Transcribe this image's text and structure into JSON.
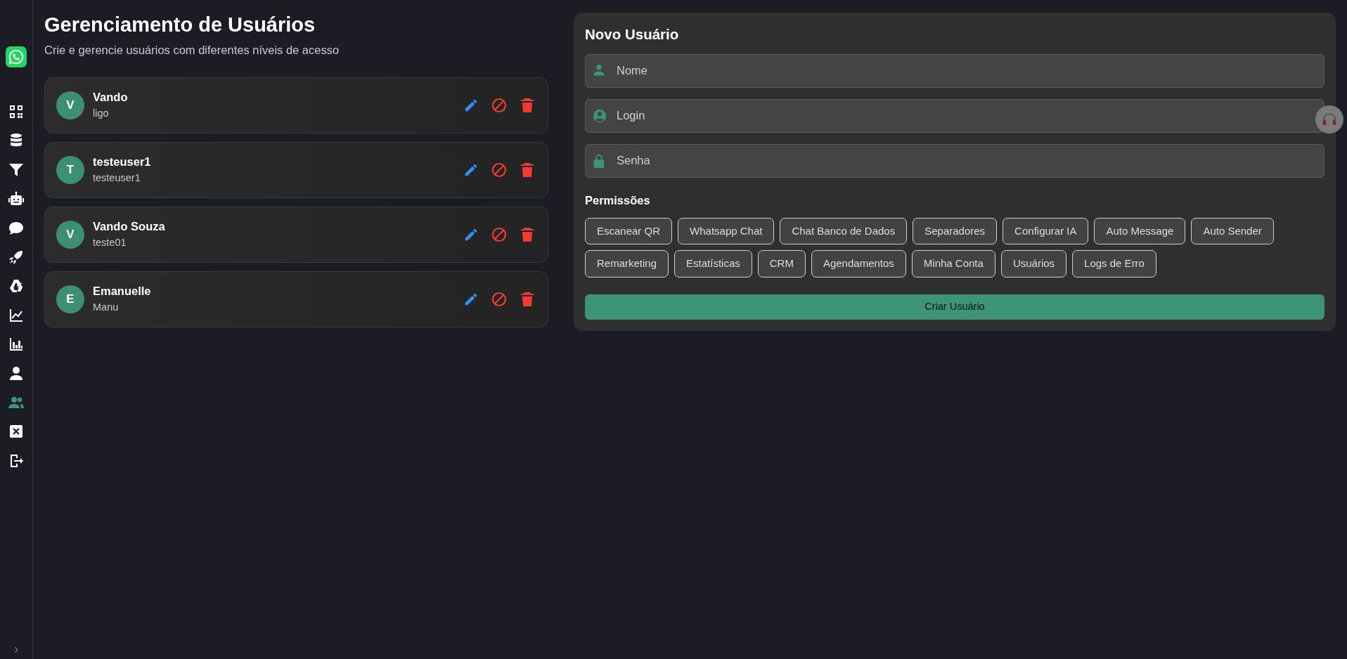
{
  "sidebar": {
    "items": [
      {
        "selected": false
      },
      {
        "selected": false
      },
      {
        "selected": false
      },
      {
        "selected": false
      },
      {
        "selected": false
      },
      {
        "selected": false
      },
      {
        "selected": false
      },
      {
        "selected": false
      },
      {
        "selected": false
      },
      {
        "selected": false
      },
      {
        "selected": true
      },
      {
        "selected": false
      },
      {
        "selected": false
      }
    ],
    "expand_toggle": "›"
  },
  "header": {
    "title": "Gerenciamento de Usuários",
    "subtitle": "Crie e gerencie usuários com diferentes níveis de acesso"
  },
  "users": [
    {
      "initial": "V",
      "name": "Vando",
      "login": "ligo"
    },
    {
      "initial": "T",
      "name": "testeuser1",
      "login": "testeuser1"
    },
    {
      "initial": "V",
      "name": "Vando Souza",
      "login": "teste01"
    },
    {
      "initial": "E",
      "name": "Emanuelle",
      "login": "Manu"
    }
  ],
  "form": {
    "title": "Novo Usuário",
    "fields": [
      {
        "kind": "person",
        "placeholder": "Nome"
      },
      {
        "kind": "account",
        "placeholder": "Login"
      },
      {
        "kind": "lock",
        "placeholder": "Senha"
      }
    ],
    "permissions_label": "Permissões",
    "permissions": [
      {
        "label": "Escanear QR",
        "selected": false
      },
      {
        "label": "Whatsapp Chat",
        "selected": false
      },
      {
        "label": "Chat Banco de Dados",
        "selected": false
      },
      {
        "label": "Separadores",
        "selected": false
      },
      {
        "label": "Configurar IA",
        "selected": false
      },
      {
        "label": "Auto Message",
        "selected": false
      },
      {
        "label": "Auto Sender",
        "selected": false
      },
      {
        "label": "Remarketing",
        "selected": false
      },
      {
        "label": "Estatísticas",
        "selected": false
      },
      {
        "label": "CRM",
        "selected": false
      },
      {
        "label": "Agendamentos",
        "selected": false
      },
      {
        "label": "Minha Conta",
        "selected": false
      },
      {
        "label": "Usuários",
        "selected": false
      },
      {
        "label": "Logs de Erro",
        "selected": false
      }
    ],
    "submit": "Criar Usuário"
  }
}
